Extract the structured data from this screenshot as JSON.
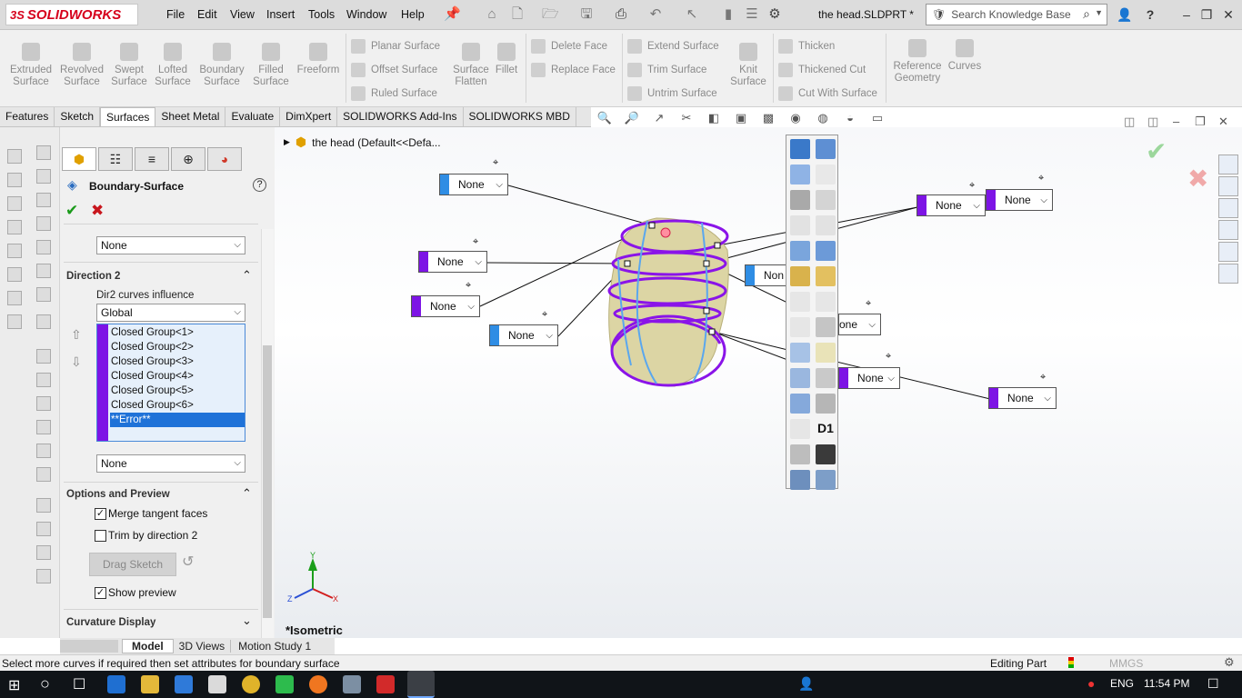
{
  "app": {
    "logo_prefix": "3S",
    "logo_text": "SOLIDWORKS",
    "doc_title": "the head.SLDPRT *"
  },
  "menu": [
    "File",
    "Edit",
    "View",
    "Insert",
    "Tools",
    "Window",
    "Help"
  ],
  "search": {
    "placeholder": "Search Knowledge Base"
  },
  "ribbon": {
    "big_buttons": [
      "Extruded Surface",
      "Revolved Surface",
      "Swept Surface",
      "Lofted Surface",
      "Boundary Surface",
      "Filled Surface",
      "Freeform"
    ],
    "group1": [
      "Planar Surface",
      "Offset Surface",
      "Ruled Surface"
    ],
    "mid_buttons": [
      "Surface Flatten",
      "Fillet"
    ],
    "group2": [
      "Delete Face",
      "Replace Face"
    ],
    "group3": [
      "Extend Surface",
      "Trim Surface",
      "Untrim Surface"
    ],
    "knit": "Knit Surface",
    "group4": [
      "Thicken",
      "Thickened Cut",
      "Cut With Surface"
    ],
    "ref": "Reference Geometry",
    "curves": "Curves"
  },
  "tabs": [
    "Features",
    "Sketch",
    "Surfaces",
    "Sheet Metal",
    "Evaluate",
    "DimXpert",
    "SOLIDWORKS Add-Ins",
    "SOLIDWORKS MBD"
  ],
  "active_tab": "Surfaces",
  "pm": {
    "title": "Boundary-Surface",
    "top_select": "None",
    "direction2": "Direction 2",
    "dir2_label": "Dir2 curves influence",
    "dir2_value": "Global",
    "groups": [
      "Closed Group<1>",
      "Closed Group<2>",
      "Closed Group<3>",
      "Closed Group<4>",
      "Closed Group<5>",
      "Closed Group<6>"
    ],
    "error_item": "**Error**",
    "bottom_select": "None",
    "options": "Options and Preview",
    "merge": "Merge tangent faces",
    "trim": "Trim by direction 2",
    "drag": "Drag Sketch",
    "preview": "Show preview",
    "curvature": "Curvature Display"
  },
  "viewport": {
    "tree_label": "the head  (Default<<Defa...",
    "callout_label": "None",
    "callout_partial": "one",
    "callout_partial2": "Non",
    "view_name": "*Isometric",
    "palette_label": "D1"
  },
  "colors": {
    "accent": "#7d14e5",
    "blue": "#2f8de4",
    "select": "#1f72d8"
  },
  "bottom_tabs": [
    "Model",
    "3D Views",
    "Motion Study 1"
  ],
  "status": {
    "message": "Select more curves if required then set attributes for boundary surface",
    "mode": "Editing Part",
    "units": "MMGS"
  },
  "taskbar": {
    "lang": "ENG",
    "time": "11:54 PM"
  }
}
